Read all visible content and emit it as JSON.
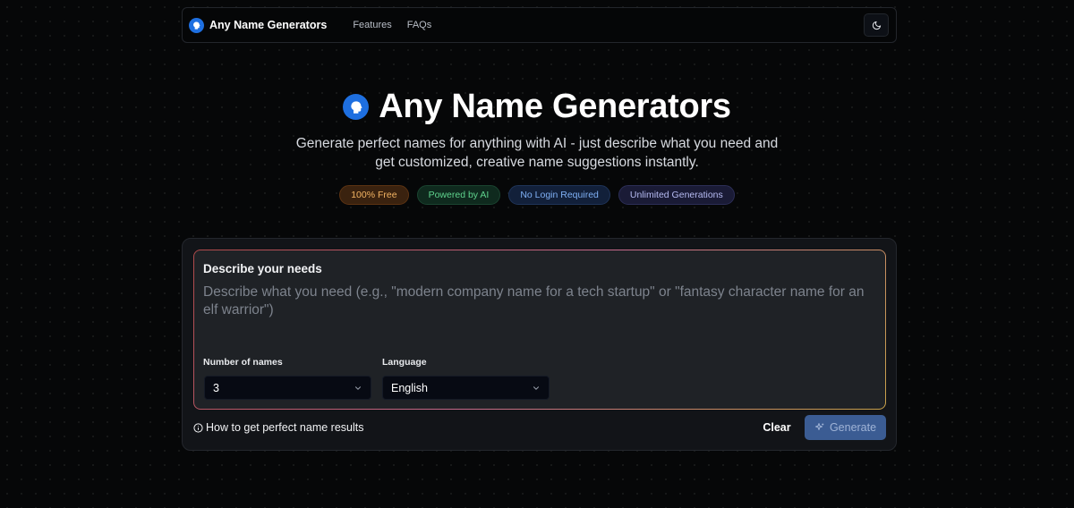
{
  "nav": {
    "brand": "Any Name Generators",
    "links": [
      "Features",
      "FAQs"
    ],
    "theme_icon": "moon-icon"
  },
  "hero": {
    "title": "Any Name Generators",
    "subtitle_line1": "Generate perfect names for anything with AI - just describe what you need and",
    "subtitle_line2": "get customized, creative name suggestions instantly.",
    "badges": [
      {
        "label": "100% Free",
        "color": "#f3b463"
      },
      {
        "label": "Powered by AI",
        "color": "#5fd38d"
      },
      {
        "label": "No Login Required",
        "color": "#7fb0f5"
      },
      {
        "label": "Unlimited Generations",
        "color": "#b6bbf3"
      }
    ]
  },
  "form": {
    "needs_label": "Describe your needs",
    "needs_placeholder": "Describe what you need (e.g., \"modern company name for a tech startup\" or \"fantasy character name for an elf warrior\")",
    "needs_value": "",
    "count_label": "Number of names",
    "count_value": "3",
    "language_label": "Language",
    "language_value": "English",
    "help_text": "How to get perfect name results",
    "clear_label": "Clear",
    "generate_label": "Generate"
  },
  "colors": {
    "accent": "#1e6fe0",
    "generate_button": "#3b5c93"
  }
}
